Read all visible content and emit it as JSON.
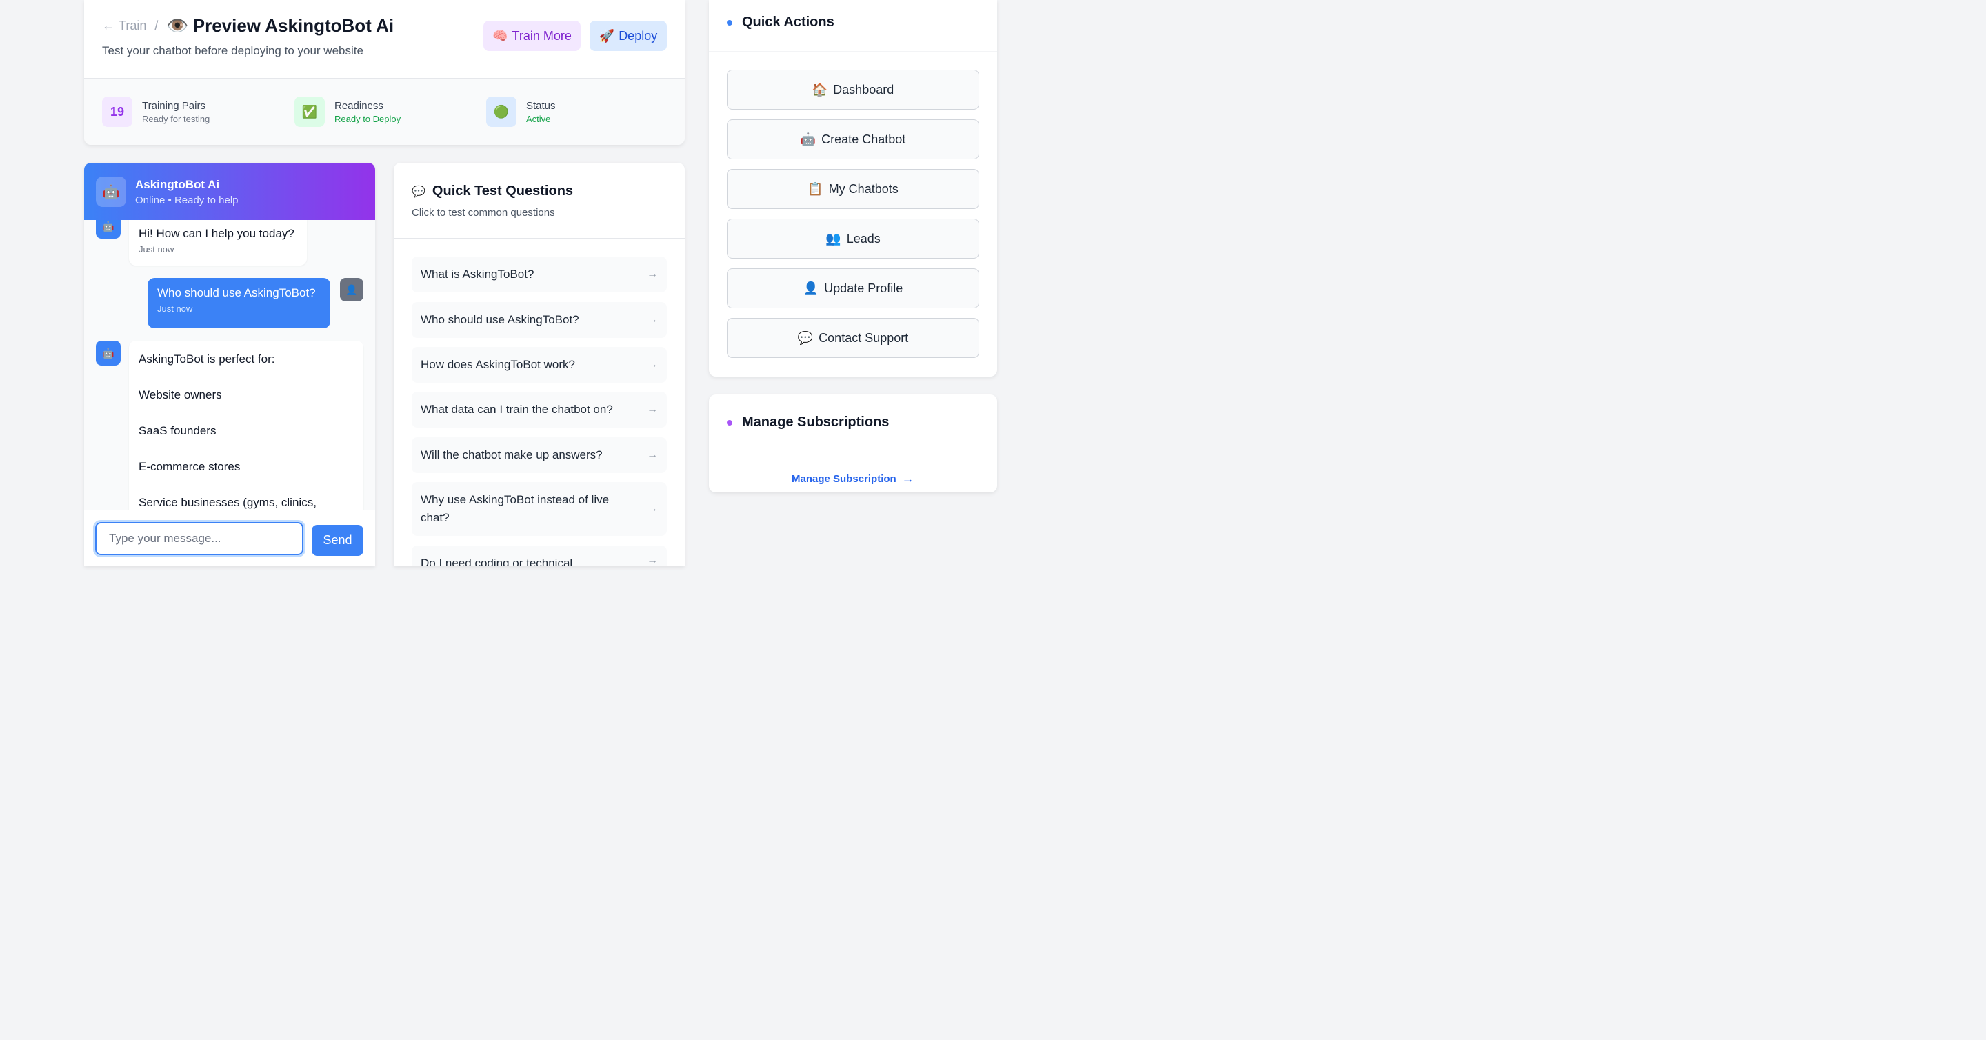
{
  "header": {
    "back_label": "Train",
    "separator": "/",
    "title_icon": "👁️",
    "title": "Preview AskingtoBot Ai",
    "subtitle": "Test your chatbot before deploying to your website",
    "train_more_icon": "🧠",
    "train_more_label": "Train More",
    "deploy_icon": "🚀",
    "deploy_label": "Deploy"
  },
  "stats": [
    {
      "icon_text": "19",
      "label": "Training Pairs",
      "sub": "Ready for testing"
    },
    {
      "icon_text": "✅",
      "label": "Readiness",
      "sub": "Ready to Deploy"
    },
    {
      "icon_text": "🟢",
      "label": "Status",
      "sub": "Active"
    }
  ],
  "chat": {
    "bot_avatar": "🤖",
    "user_avatar": "👤",
    "name": "AskingtoBot Ai",
    "status": "Online • Ready to help",
    "messages": [
      {
        "text": "Hi! How can I help you today?",
        "time": "Just now"
      },
      {
        "text": "Who should use AskingToBot?",
        "time": "Just now"
      },
      {
        "lines": [
          "AskingToBot is perfect for:",
          "Website owners",
          "SaaS founders",
          "E-commerce stores",
          "Service businesses (gyms, clinics,"
        ]
      }
    ],
    "input_placeholder": "Type your message...",
    "send_label": "Send"
  },
  "quick_test": {
    "icon": "💬",
    "title": "Quick Test Questions",
    "subtitle": "Click to test common questions",
    "arrow": "→",
    "questions": [
      "What is AskingToBot?",
      "Who should use AskingToBot?",
      "How does AskingToBot work?",
      "What data can I train the chatbot on?",
      "Will the chatbot make up answers?",
      "Why use AskingToBot instead of live chat?",
      "Do I need coding or technical"
    ]
  },
  "quick_actions": {
    "title": "Quick Actions",
    "items": [
      {
        "icon": "🏠",
        "label": "Dashboard"
      },
      {
        "icon": "🤖",
        "label": "Create Chatbot"
      },
      {
        "icon": "📋",
        "label": "My Chatbots"
      },
      {
        "icon": "👥",
        "label": "Leads"
      },
      {
        "icon": "👤",
        "label": "Update Profile"
      },
      {
        "icon": "💬",
        "label": "Contact Support"
      }
    ]
  },
  "subscriptions": {
    "title": "Manage Subscriptions",
    "link_label": "Manage Subscription",
    "link_arrow": "→"
  },
  "colors": {
    "primary": "#3b82f6",
    "purple": "#9333ea",
    "green": "#16a34a"
  }
}
